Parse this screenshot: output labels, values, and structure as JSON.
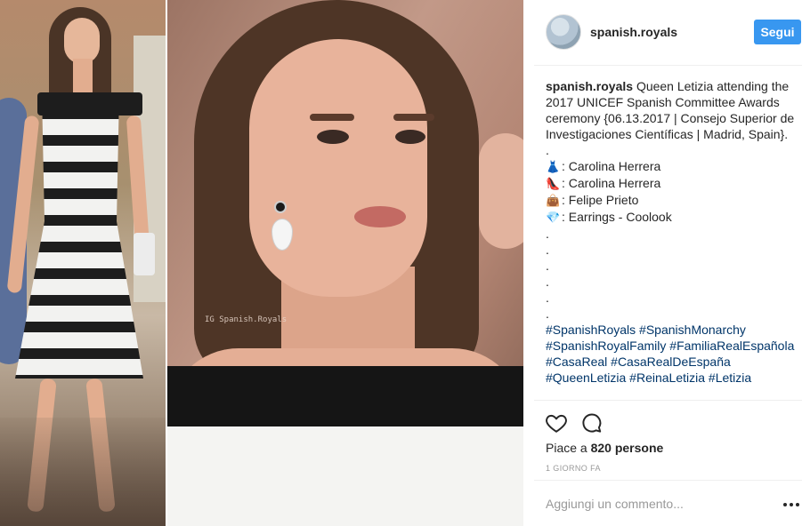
{
  "post": {
    "username": "spanish.royals",
    "follow_label": "Segui",
    "watermark": "IG Spanish.Royals",
    "caption": {
      "user": "spanish.royals",
      "text": "Queen Letizia attending the 2017 UNICEF Spanish Committee Awards ceremony {06.13.2017 | Consejo Superior de Investigaciones Científicas | Madrid, Spain}.",
      "dot_lines": [
        ".",
        ".",
        ".",
        ".",
        ".",
        ".",
        "."
      ],
      "credits": [
        {
          "emoji": "👗",
          "icon": "dress-icon",
          "text": ": Carolina Herrera"
        },
        {
          "emoji": "👠",
          "icon": "heel-shoe-icon",
          "text": ": Carolina Herrera"
        },
        {
          "emoji": "👜",
          "icon": "handbag-icon",
          "text": ": Felipe Prieto"
        },
        {
          "emoji": "💎",
          "icon": "gem-icon",
          "text": ": Earrings - Coolook"
        }
      ],
      "hashtags": "#SpanishRoyals #SpanishMonarchy #SpanishRoyalFamily #FamiliaRealEspañola #CasaReal #CasaRealDeEspaña #QueenLetizia #ReinaLetizia #Letizia"
    },
    "likes": {
      "prefix": "Piace a ",
      "count": "820 persone"
    },
    "time": "1 GIORNO FA",
    "comment_placeholder": "Aggiungi un commento...",
    "colors": {
      "follow_button": "#3897f0",
      "hashtag": "#003569",
      "muted": "#999999"
    }
  }
}
